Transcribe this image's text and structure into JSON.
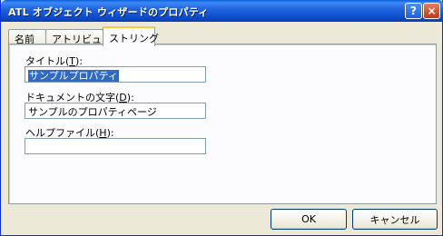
{
  "window": {
    "title": "ATL オブジェクト ウィザードのプロパティ",
    "help_glyph": "?",
    "close_glyph": "×"
  },
  "tabs": [
    {
      "label": "名前",
      "active": false
    },
    {
      "label": "アトリビュート",
      "active": false
    },
    {
      "label": "ストリング",
      "active": true
    }
  ],
  "fields": {
    "title": {
      "label_before": "タイトル(",
      "mnemonic": "T",
      "label_after": "):",
      "value": "サンプルプロパティ",
      "selected": true
    },
    "doc_string": {
      "label_before": "ドキュメントの文字(",
      "mnemonic": "D",
      "label_after": "):",
      "value": "サンプルのプロパティページ"
    },
    "help_file": {
      "label_before": "ヘルプファイル(",
      "mnemonic": "H",
      "label_after": "):",
      "value": ""
    }
  },
  "buttons": {
    "ok": "OK",
    "cancel": "キャンセル"
  },
  "colors": {
    "titlebar": "#0a5fd8",
    "selection": "#316ac5",
    "active_tab_accent": "#ffc83c"
  }
}
